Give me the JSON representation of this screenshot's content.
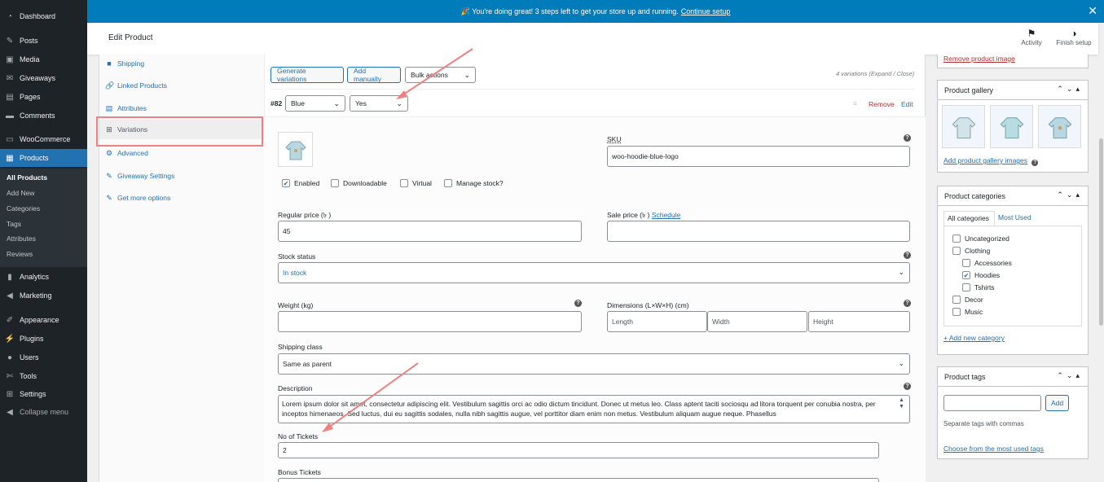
{
  "notice": {
    "text": "🎉 You're doing great! 3 steps left to get your store up and running.",
    "link": "Continue setup"
  },
  "header": {
    "title": "Edit Product",
    "activity": "Activity",
    "finish_setup": "Finish setup"
  },
  "sidebar": {
    "items": [
      {
        "label": "Dashboard",
        "icon": "dashboard-icon"
      },
      {
        "label": "Posts",
        "icon": "pin-icon"
      },
      {
        "label": "Media",
        "icon": "media-icon"
      },
      {
        "label": "Giveaways",
        "icon": "gift-icon"
      },
      {
        "label": "Pages",
        "icon": "page-icon"
      },
      {
        "label": "Comments",
        "icon": "comment-icon"
      },
      {
        "label": "WooCommerce",
        "icon": "woo-icon"
      },
      {
        "label": "Products",
        "icon": "archive-icon"
      },
      {
        "label": "Analytics",
        "icon": "chart-icon"
      },
      {
        "label": "Marketing",
        "icon": "megaphone-icon"
      },
      {
        "label": "Appearance",
        "icon": "brush-icon"
      },
      {
        "label": "Plugins",
        "icon": "plugin-icon"
      },
      {
        "label": "Users",
        "icon": "user-icon"
      },
      {
        "label": "Tools",
        "icon": "wrench-icon"
      },
      {
        "label": "Settings",
        "icon": "settings-icon"
      },
      {
        "label": "Collapse menu",
        "icon": "collapse-icon"
      }
    ],
    "submenu": [
      "All Products",
      "Add New",
      "Categories",
      "Tags",
      "Attributes",
      "Reviews"
    ]
  },
  "tabs": [
    "Shipping",
    "Linked Products",
    "Attributes",
    "Variations",
    "Advanced",
    "Giveaway Settings",
    "Get more options"
  ],
  "variations": {
    "generate": "Generate variations",
    "add_manually": "Add manually",
    "bulk_actions": "Bulk actions",
    "count_text": "4 variations (Expand / Close)",
    "id": "#82",
    "color": "Blue",
    "logo": "Yes",
    "remove": "Remove",
    "edit": "Edit"
  },
  "form": {
    "sku_label": "SKU",
    "sku_value": "woo-hoodie-blue-logo",
    "enabled": "Enabled",
    "downloadable": "Downloadable",
    "virtual": "Virtual",
    "manage_stock": "Manage stock?",
    "regular_price_label": "Regular price (৳ )",
    "regular_price_value": "45",
    "sale_price_label": "Sale price (৳ )",
    "schedule": "Schedule",
    "stock_status_label": "Stock status",
    "stock_status_value": "In stock",
    "weight_label": "Weight (kg)",
    "dimensions_label": "Dimensions (L×W×H) (cm)",
    "length_ph": "Length",
    "width_ph": "Width",
    "height_ph": "Height",
    "shipping_class_label": "Shipping class",
    "shipping_class_value": "Same as parent",
    "description_label": "Description",
    "description_value": "Lorem ipsum dolor sit amet, consectetur adipiscing elit. Vestibulum sagittis orci ac odio dictum tincidunt. Donec ut metus leo. Class aptent taciti sociosqu ad litora torquent per conubia nostra, per inceptos himenaeos. Sed luctus, dui eu sagittis sodales, nulla nibh sagittis augue, vel porttitor diam enim non metus. Vestibulum aliquam augue neque. Phasellus",
    "tickets_label": "No of Tickets",
    "tickets_value": "2",
    "bonus_label": "Bonus Tickets"
  },
  "right": {
    "remove_image": "Remove product image",
    "gallery_title": "Product gallery",
    "add_gallery": "Add product gallery images",
    "categories_title": "Product categories",
    "cat_tab_all": "All categories",
    "cat_tab_most": "Most Used",
    "categories": [
      {
        "label": "Uncategorized",
        "checked": false,
        "indent": 0
      },
      {
        "label": "Clothing",
        "checked": false,
        "indent": 0
      },
      {
        "label": "Accessories",
        "checked": false,
        "indent": 1
      },
      {
        "label": "Hoodies",
        "checked": true,
        "indent": 1
      },
      {
        "label": "Tshirts",
        "checked": false,
        "indent": 1
      },
      {
        "label": "Decor",
        "checked": false,
        "indent": 0
      },
      {
        "label": "Music",
        "checked": false,
        "indent": 0
      }
    ],
    "add_category": "+ Add new category",
    "tags_title": "Product tags",
    "tags_add": "Add",
    "tags_hint": "Separate tags with commas",
    "tags_most": "Choose from the most used tags"
  },
  "colors": {
    "accent": "#2271b1",
    "sidebar": "#1d2327",
    "notice": "#007cba",
    "highlight": "#f08080"
  }
}
